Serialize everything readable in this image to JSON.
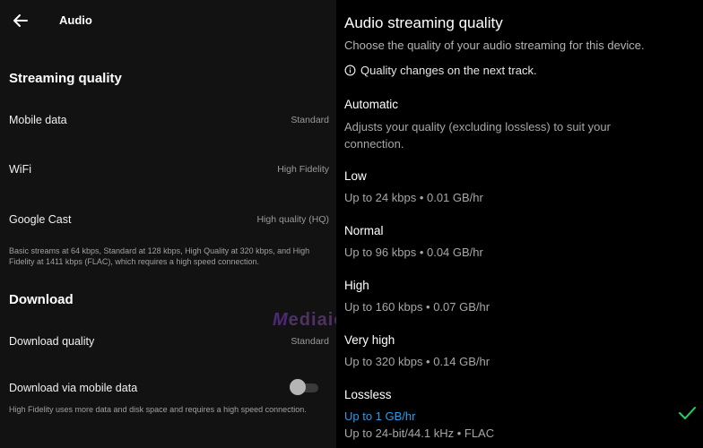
{
  "left": {
    "header": {
      "title": "Audio",
      "back_icon": "arrow-left-icon"
    },
    "streaming": {
      "heading": "Streaming quality",
      "rows": [
        {
          "label": "Mobile data",
          "value": "Standard"
        },
        {
          "label": "WiFi",
          "value": "High Fidelity"
        },
        {
          "label": "Google Cast",
          "value": "High quality (HQ)"
        }
      ],
      "note": "Basic streams at 64 kbps, Standard at 128 kbps, High Quality at 320 kbps, and High Fidelity at 1411 kbps (FLAC), which requires a high speed connection."
    },
    "download": {
      "heading": "Download",
      "quality_label": "Download quality",
      "quality_value": "Standard",
      "mobile_label": "Download via mobile data",
      "mobile_enabled": false,
      "note": "High Fidelity uses more data and disk space and requires a high speed connection."
    },
    "watermark": {
      "m": "M",
      "rest": "ediaio"
    }
  },
  "right": {
    "title": "Audio streaming quality",
    "subtitle": "Choose the quality of your audio streaming for this device.",
    "info": "Quality changes on the next track.",
    "options": [
      {
        "name": "Automatic",
        "desc": "Adjusts your quality (excluding lossless) to suit your connection."
      },
      {
        "name": "Low",
        "desc": "Up to 24 kbps • 0.01 GB/hr"
      },
      {
        "name": "Normal",
        "desc": "Up to 96 kbps • 0.04 GB/hr"
      },
      {
        "name": "High",
        "desc": "Up to 160 kbps • 0.07 GB/hr"
      },
      {
        "name": "Very high",
        "desc": "Up to 320 kbps • 0.14 GB/hr"
      },
      {
        "name": "Lossless",
        "desc": "Up to 1 GB/hr",
        "desc2": "Up to 24-bit/44.1 kHz • FLAC",
        "selected": true
      }
    ],
    "accent_color": "#2e9be6",
    "check_color": "#1ed760"
  }
}
